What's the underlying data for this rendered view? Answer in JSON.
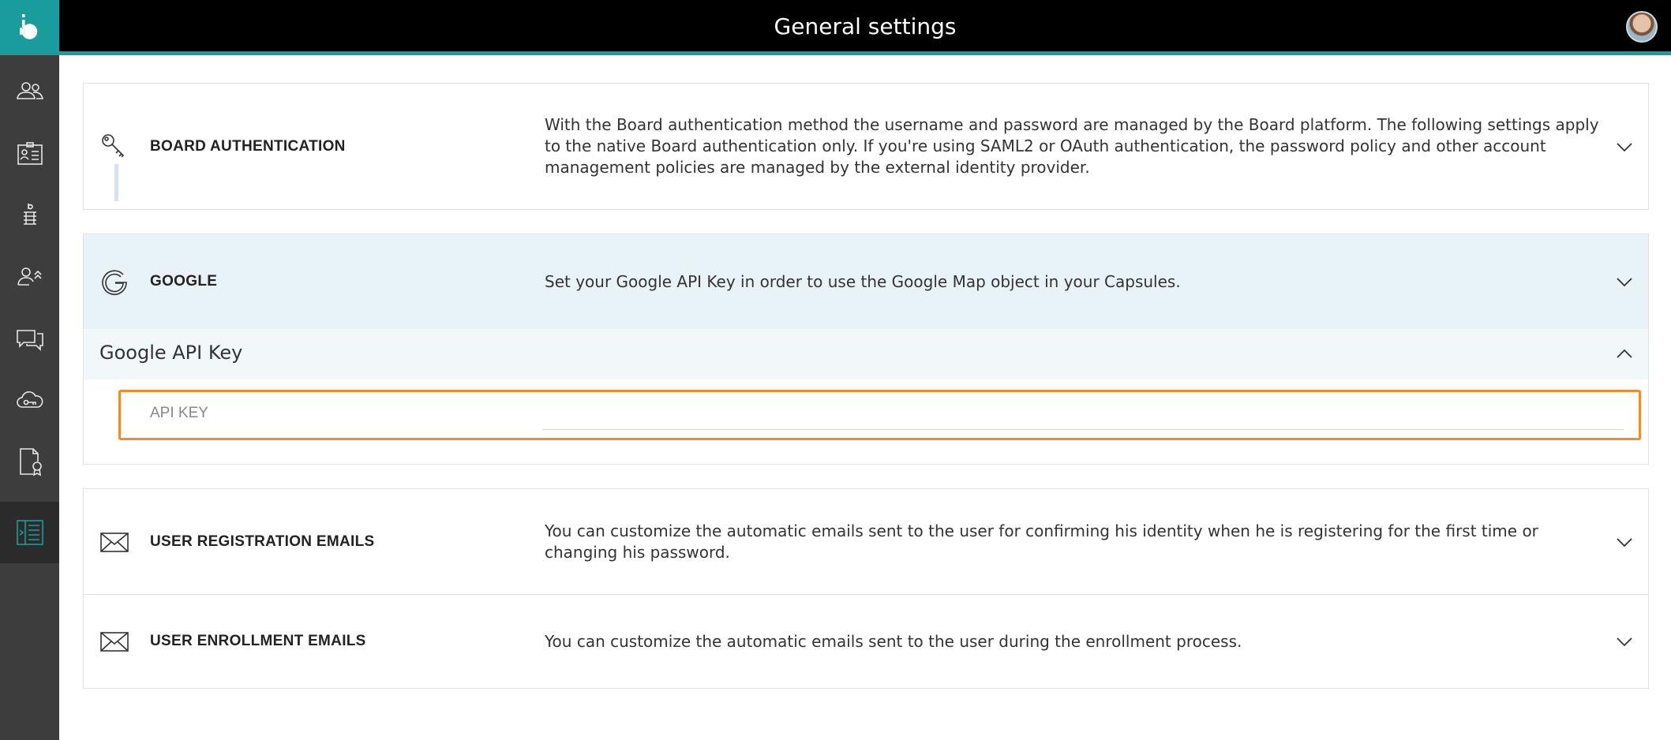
{
  "header": {
    "title": "General settings"
  },
  "sidebar": {
    "logo_icon": "board-logo-icon",
    "items": [
      {
        "icon": "users-icon"
      },
      {
        "icon": "id-card-icon"
      },
      {
        "icon": "database-icon"
      },
      {
        "icon": "user-roles-icon"
      },
      {
        "icon": "chat-icon"
      },
      {
        "icon": "cloud-key-icon"
      },
      {
        "icon": "certificate-icon"
      },
      {
        "icon": "settings-list-icon",
        "active": true
      }
    ]
  },
  "sections": {
    "board_auth": {
      "title": "BOARD AUTHENTICATION",
      "description": "With the Board authentication method the username and password are managed by the Board platform. The following settings apply to the native Board authentication only. If you're using SAML2 or OAuth authentication, the password policy and other account management policies are managed by the external identity provider.",
      "icon": "key-icon"
    },
    "google": {
      "title": "GOOGLE",
      "description": "Set your Google API Key in order to use the Google Map object in your Capsules.",
      "icon": "google-icon",
      "subsection_title": "Google API Key",
      "field_label": "API KEY",
      "field_value": ""
    },
    "registration_emails": {
      "title": "USER REGISTRATION EMAILS",
      "description": "You can customize the automatic emails sent to the user for confirming his identity when he is registering for the first time or changing his password.",
      "icon": "envelope-icon"
    },
    "enrollment_emails": {
      "title": "USER ENROLLMENT EMAILS",
      "description": "You can customize the automatic emails sent to the user during the enrollment process.",
      "icon": "envelope-icon"
    }
  },
  "colors": {
    "accent": "#1a9c9c",
    "highlight": "#f08a2c",
    "sidebar": "#3d3d3d"
  }
}
